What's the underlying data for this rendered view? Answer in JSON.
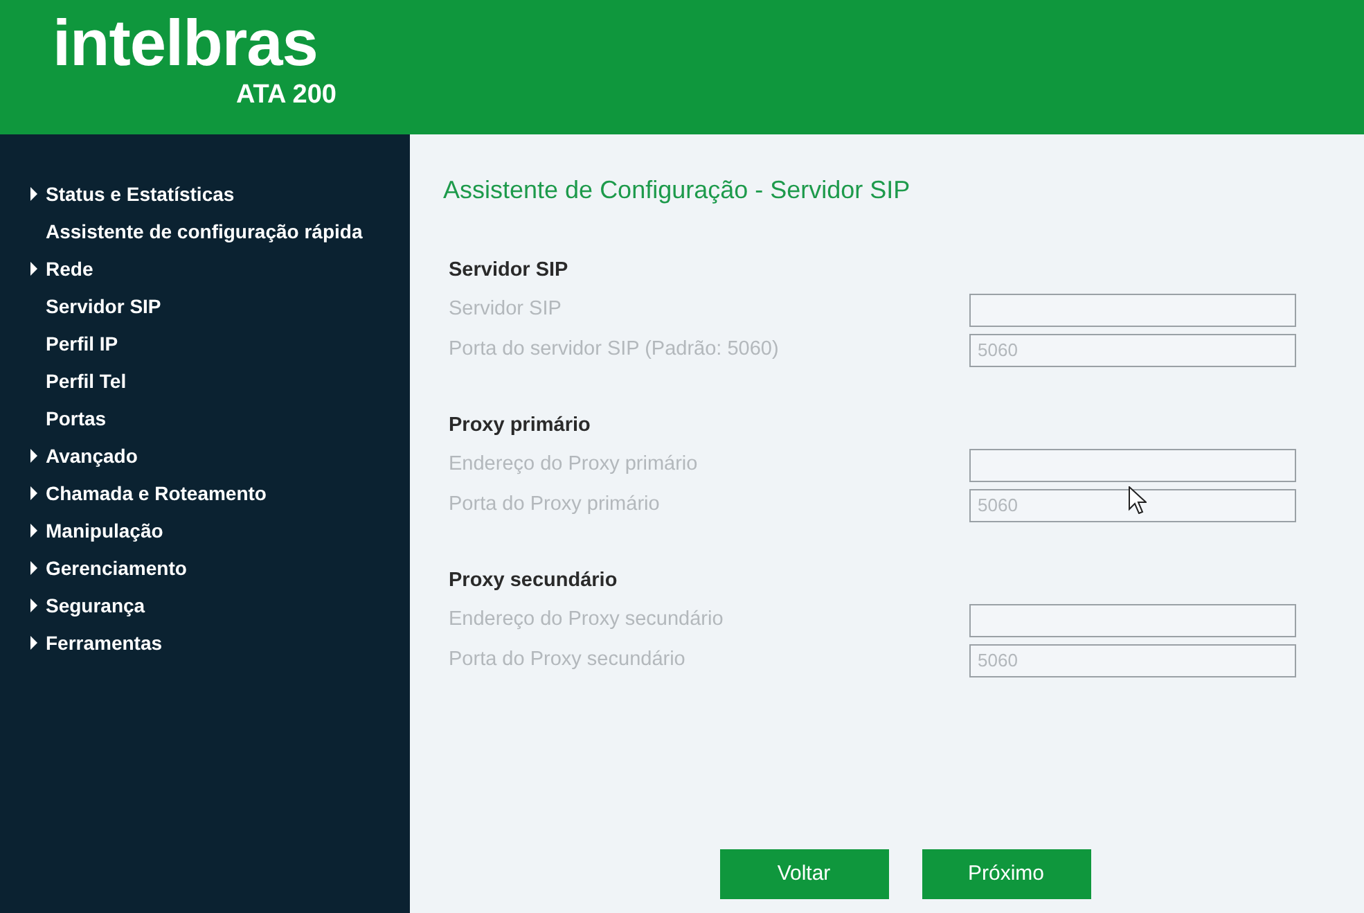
{
  "header": {
    "logo": "intelbras",
    "model": "ATA 200"
  },
  "sidebar": {
    "items": [
      {
        "label": "Status e Estatísticas",
        "kind": "group"
      },
      {
        "label": "Assistente de configuração rápida",
        "kind": "page"
      },
      {
        "label": "Rede",
        "kind": "group"
      },
      {
        "label": "Servidor SIP",
        "kind": "page"
      },
      {
        "label": "Perfil IP",
        "kind": "page"
      },
      {
        "label": "Perfil Tel",
        "kind": "page"
      },
      {
        "label": "Portas",
        "kind": "page"
      },
      {
        "label": "Avançado",
        "kind": "group"
      },
      {
        "label": "Chamada e Roteamento",
        "kind": "group"
      },
      {
        "label": "Manipulação",
        "kind": "group"
      },
      {
        "label": "Gerenciamento",
        "kind": "group"
      },
      {
        "label": "Segurança",
        "kind": "group"
      },
      {
        "label": "Ferramentas",
        "kind": "group"
      }
    ]
  },
  "page": {
    "title": "Assistente de Configuração - Servidor SIP",
    "sections": [
      {
        "heading": "Servidor SIP",
        "fields": [
          {
            "label": "Servidor SIP"
          },
          {
            "label": "Porta do servidor SIP (Padrão: 5060)",
            "value": "5060"
          }
        ]
      },
      {
        "heading": "Proxy primário",
        "fields": [
          {
            "label": "Endereço do Proxy primário"
          },
          {
            "label": "Porta do Proxy primário",
            "value": "5060"
          }
        ]
      },
      {
        "heading": "Proxy secundário",
        "fields": [
          {
            "label": "Endereço do Proxy secundário"
          },
          {
            "label": "Porta do Proxy secundário",
            "value": "5060"
          }
        ]
      }
    ],
    "buttons": [
      "Voltar",
      "Próximo"
    ]
  }
}
